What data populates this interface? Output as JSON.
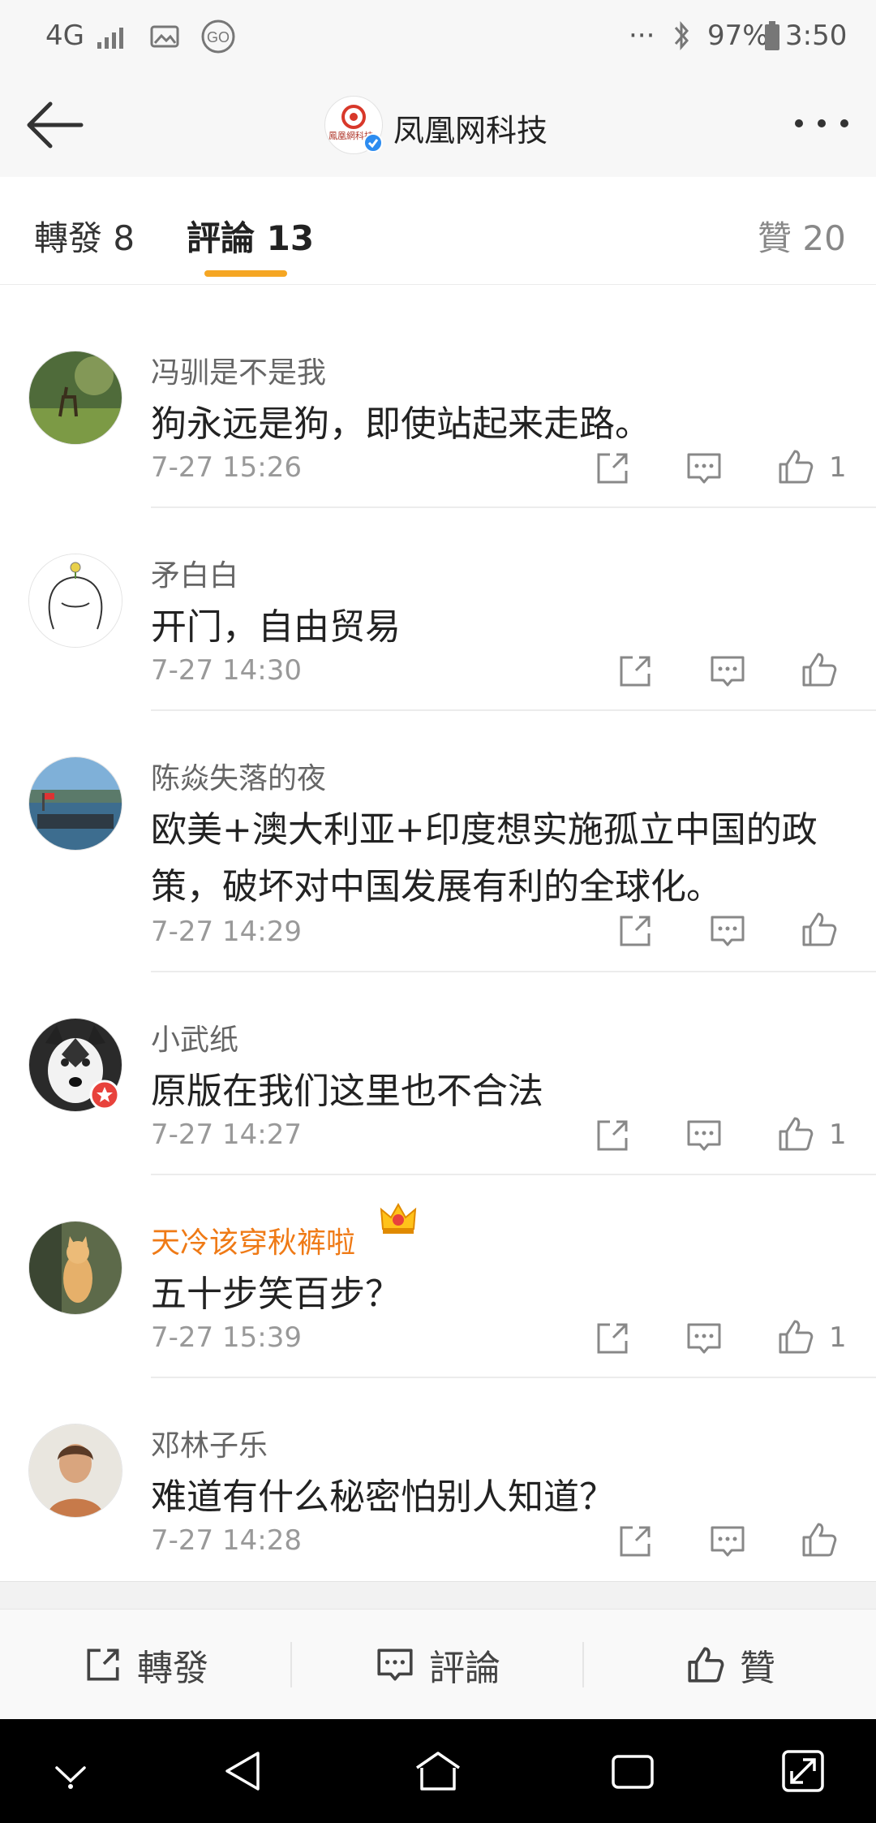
{
  "status_bar": {
    "network": "4G",
    "battery": "97%",
    "time": "3:50",
    "more": "···"
  },
  "header": {
    "title": "凤凰网科技",
    "avatar_text": "鳳凰網科技"
  },
  "tabs": {
    "repost": "轉發 8",
    "comment": "評論 13",
    "like": "贊 20"
  },
  "comments": [
    {
      "name": "冯驯是不是我",
      "text": "狗永远是狗，即使站起来走路。",
      "time": "7-27 15:26",
      "likes": "1"
    },
    {
      "name": "矛白白",
      "text": "开门，自由贸易",
      "time": "7-27 14:30",
      "likes": ""
    },
    {
      "name": "陈焱失落的夜",
      "text": "欧美+澳大利亚+印度想实施孤立中国的政策，破坏对中国发展有利的全球化。",
      "time": "7-27 14:29",
      "likes": ""
    },
    {
      "name": "小武纸",
      "text": "原版在我们这里也不合法",
      "time": "7-27 14:27",
      "likes": "1"
    },
    {
      "name": "天冷该穿秋裤啦",
      "text": "五十步笑百步？",
      "time": "7-27 15:39",
      "likes": "1"
    },
    {
      "name": "邓林子乐",
      "text": "难道有什么秘密怕别人知道？",
      "time": "7-27 14:28",
      "likes": ""
    }
  ],
  "bottom_bar": {
    "repost": "轉發",
    "comment": "評論",
    "like": "贊"
  },
  "colors": {
    "accent": "#f5a623",
    "vip_name": "#ef7a16",
    "verified": "#2d8cf0"
  }
}
